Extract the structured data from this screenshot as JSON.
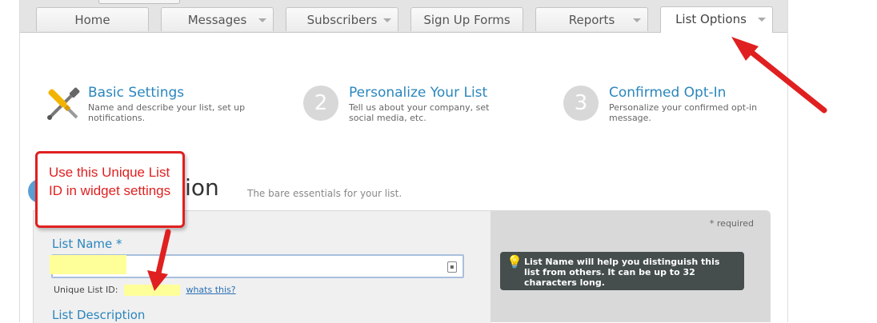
{
  "tabs": [
    {
      "label": "Home",
      "dropdown": false,
      "active": false
    },
    {
      "label": "Messages",
      "dropdown": true,
      "active": false
    },
    {
      "label": "Subscribers",
      "dropdown": true,
      "active": false
    },
    {
      "label": "Sign Up Forms",
      "dropdown": false,
      "active": false
    },
    {
      "label": "Reports",
      "dropdown": true,
      "active": false
    },
    {
      "label": "List Options",
      "dropdown": true,
      "active": true
    }
  ],
  "steps": [
    {
      "icon": "wrench-screwdriver-icon",
      "title": "Basic Settings",
      "description": "Name and describe your list, set up notifications."
    },
    {
      "number": "2",
      "title": "Personalize Your List",
      "description": "Tell us about your company, set social media, etc."
    },
    {
      "number": "3",
      "title": "Confirmed Opt-In",
      "description": "Personalize your confirmed opt-in message."
    }
  ],
  "section": {
    "heading": "ation",
    "subheading": "The bare essentials for your list."
  },
  "form": {
    "list_name_label": "List Name *",
    "unique_id_label": "Unique List ID:",
    "whats_this_link": "whats this?",
    "list_description_label": "List Description"
  },
  "side": {
    "required": "* required",
    "tip": "List Name will help you distinguish this list from others. It can be up to 32 characters long.",
    "tip_icon": "lightbulb-icon"
  },
  "callout": {
    "text": "Use this Unique List ID in widget settings",
    "color": "#e02020"
  },
  "colors": {
    "accent": "#2a86bd",
    "annotation": "#e02020",
    "highlight": "#ffff99"
  }
}
